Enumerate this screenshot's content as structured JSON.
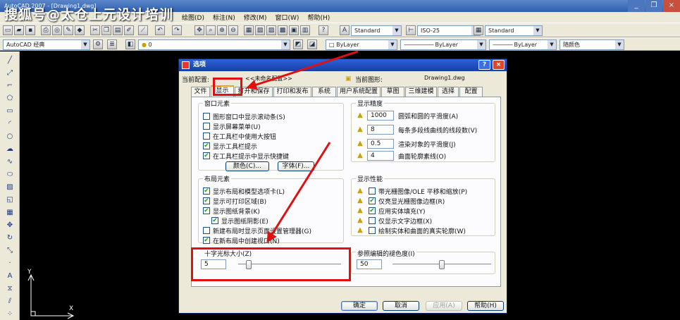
{
  "app": {
    "window_title": "AutoCAD 2007 - [Drawing1.dwg]",
    "watermark": "搜狐号@太仓上元设计培训",
    "titlebar_buttons": {
      "minimize": "_",
      "restore": "❐",
      "close": "×"
    }
  },
  "menubar": {
    "items": [
      "绘图(D)",
      "标注(N)",
      "修改(M)",
      "窗口(W)",
      "帮助(H)"
    ]
  },
  "toolbar": {
    "text_style": "Standard",
    "dim_style": "ISO-25",
    "table_style": "Standard",
    "workspace": "AutoCAD 经典",
    "layer": "0",
    "color": "ByLayer",
    "linetype": "ByLayer",
    "lineweight": "ByLayer",
    "plot_style": "随颜色"
  },
  "ucs": {
    "y_label": "Y",
    "x_label": "X"
  },
  "dialog": {
    "title": "选项",
    "help_btn": "?",
    "close_btn": "×",
    "current_profile_label": "当前配置:",
    "current_profile_value": "<<未命名配置>>",
    "current_drawing_label": "当前图形:",
    "current_drawing_value": "Drawing1.dwg",
    "tabs": [
      "文件",
      "显示",
      "打开和保存",
      "打印和发布",
      "系统",
      "用户系统配置",
      "草图",
      "三维建模",
      "选择",
      "配置"
    ],
    "window_elements": {
      "title": "窗口元素",
      "options": [
        {
          "label": "图形窗口中显示滚动条(S)",
          "checked": ""
        },
        {
          "label": "显示屏幕菜单(U)",
          "checked": ""
        },
        {
          "label": "在工具栏中使用大按钮",
          "checked": ""
        },
        {
          "label": "显示工具栏提示",
          "checked": "✔"
        },
        {
          "label": "在工具栏提示中显示快捷键",
          "checked": "✔"
        }
      ],
      "color_btn": "颜色(C)...",
      "font_btn": "字体(F)..."
    },
    "layout_elements": {
      "title": "布局元素",
      "options": [
        {
          "label": "显示布局和模型选项卡(L)",
          "checked": "✔"
        },
        {
          "label": "显示可打印区域(B)",
          "checked": "✔"
        },
        {
          "label": "显示图纸背景(K)",
          "checked": "✔"
        },
        {
          "label": "显示图纸阴影(E)",
          "checked": "✔"
        },
        {
          "label": "新建布局时显示页面设置管理器(G)",
          "checked": ""
        },
        {
          "label": "在新布局中创建视口(N)",
          "checked": "✔"
        }
      ]
    },
    "crosshair": {
      "title": "十字光标大小(Z)",
      "value": "5",
      "level": 0.08
    },
    "display_resolution": {
      "title": "显示精度",
      "rows": [
        {
          "value": "1000",
          "label": "圆弧和圆的平滑度(A)"
        },
        {
          "value": "8",
          "label": "每条多段线曲线的线段数(V)"
        },
        {
          "value": "0.5",
          "label": "渲染对象的平滑度(J)"
        },
        {
          "value": "4",
          "label": "曲面轮廓素线(O)"
        }
      ]
    },
    "display_performance": {
      "title": "显示性能",
      "options": [
        {
          "label": "带光栅图像/OLE 平移和缩放(P)",
          "checked": ""
        },
        {
          "label": "仅亮显光栅图像边框(R)",
          "checked": "✔"
        },
        {
          "label": "应用实体填充(Y)",
          "checked": "✔"
        },
        {
          "label": "仅显示文字边框(X)",
          "checked": ""
        },
        {
          "label": "绘制实体和曲面的真实轮廓(W)",
          "checked": ""
        }
      ]
    },
    "xref_fade": {
      "title": "参照编辑的褪色度(I)",
      "value": "50",
      "level": 0.5
    },
    "buttons": {
      "ok": "确定",
      "cancel": "取消",
      "apply": "应用(A)",
      "help": "帮助(H)"
    }
  },
  "colors": {
    "highlight_red": "#e01010",
    "tab_accent": "#f1a11a",
    "title_blue": "#2a62d8"
  }
}
